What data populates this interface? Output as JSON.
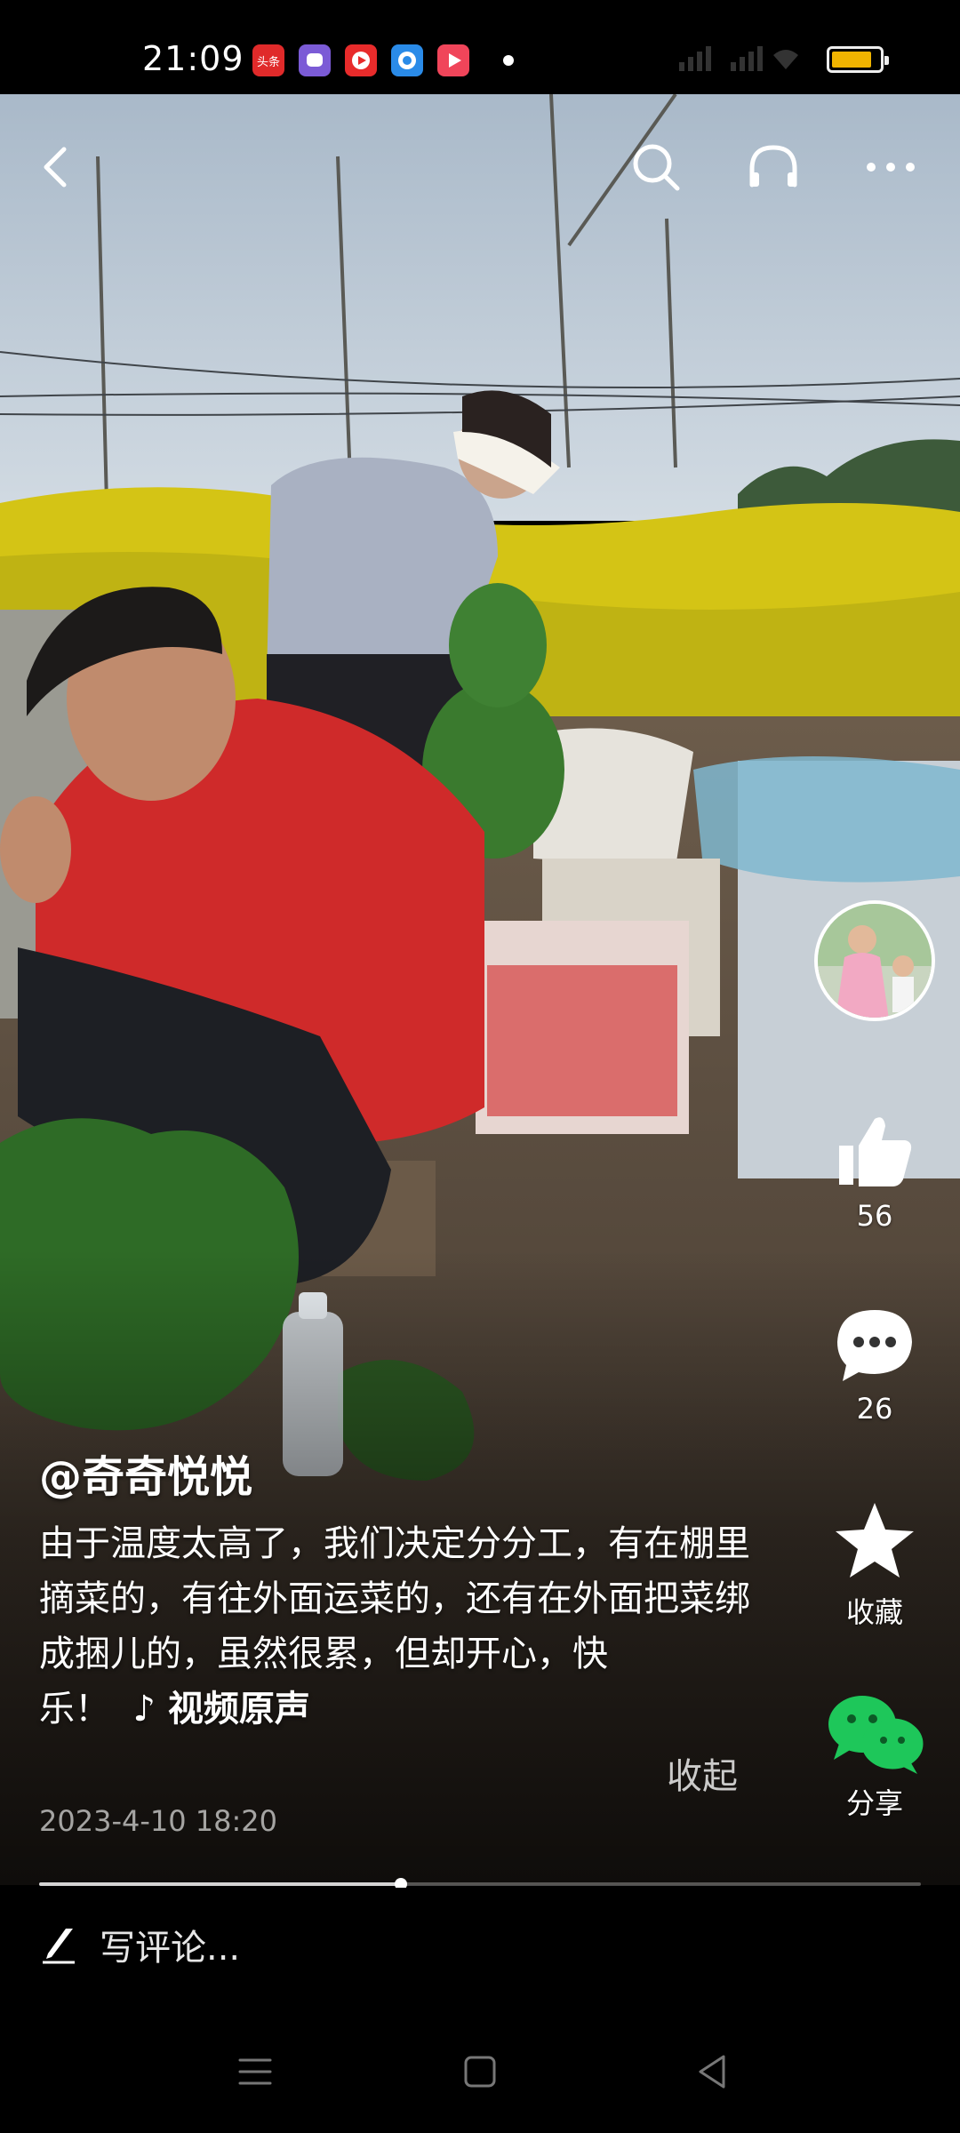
{
  "status_bar": {
    "time": "21:09",
    "notification_icons": [
      {
        "name": "toutiao-app-icon",
        "color": "#e02a2a",
        "text": "头条"
      },
      {
        "name": "chat-app-icon",
        "color": "#7b5bd6"
      },
      {
        "name": "video-app-icon",
        "color": "#e82b2b"
      },
      {
        "name": "browser-app-icon",
        "color": "#2a8be8"
      },
      {
        "name": "play-app-icon",
        "color": "#f0455a"
      }
    ],
    "battery_level": 0.85,
    "battery_color": "#f0b400"
  },
  "top_nav": {
    "back": "back-icon",
    "search": "search-icon",
    "listen": "headphones-icon",
    "more": "more-icon"
  },
  "actions": {
    "like_count": "56",
    "comment_count": "26",
    "favorite_label": "收藏",
    "share_label": "分享",
    "like_color": "#ffffff",
    "share_color": "#1ec75a"
  },
  "post": {
    "author": "@奇奇悦悦",
    "description": "由于温度太高了，我们决定分分工，有在棚里摘菜的，有往外面运菜的，还有在外面把菜绑成捆儿的，虽然很累，但却开心，快乐！",
    "music": "♪ 视频原声",
    "collapse_label": "收起",
    "date": "2023-4-10 18:20"
  },
  "playback": {
    "progress": 0.41
  },
  "comment_bar": {
    "placeholder": "写评论..."
  },
  "system_nav": {
    "menu": "menu-icon",
    "home": "home-icon",
    "back": "system-back-icon"
  }
}
